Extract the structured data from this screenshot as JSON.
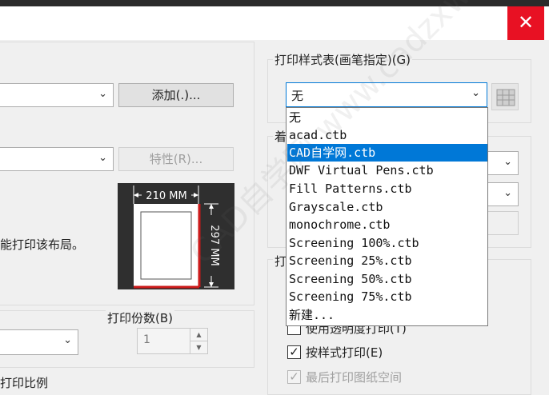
{
  "window": {
    "close_glyph": "✕"
  },
  "add_button_label": "添加(.)...",
  "properties_button_label": "特性(R)...",
  "prompt_text": "能打印该布局。",
  "copies": {
    "label": "打印份数(B)",
    "value": "1"
  },
  "scale_label": "打印比例",
  "plot_style_table": {
    "label": "打印样式表(画笔指定)(G)",
    "selected": "无",
    "options": [
      "无",
      "acad.ctb",
      "CAD自学网.ctb",
      "DWF Virtual Pens.ctb",
      "Fill Patterns.ctb",
      "Grayscale.ctb",
      "monochrome.ctb",
      "Screening 100%.ctb",
      "Screening 25%.ctb",
      "Screening 50%.ctb",
      "Screening 75%.ctb",
      "新建..."
    ],
    "highlighted_option": "CAD自学网.ctb"
  },
  "shaded_viewport_label_fragment": "着",
  "options_label_fragment": "打",
  "paper_preview": {
    "width_label": "210 MM",
    "height_label": "297 MM"
  },
  "checkboxes": {
    "transparency": {
      "label": "使用透明度打印(T)",
      "checked": false
    },
    "plot_with_styles": {
      "label": "按样式打印(E)",
      "checked": true
    },
    "paperspace_last": {
      "label": "最后打印图纸空间",
      "checked": true
    }
  },
  "watermark_text": "CAD自学网 www.cadzxw.com",
  "colors": {
    "accent": "#0078d7",
    "close": "#e81123"
  }
}
